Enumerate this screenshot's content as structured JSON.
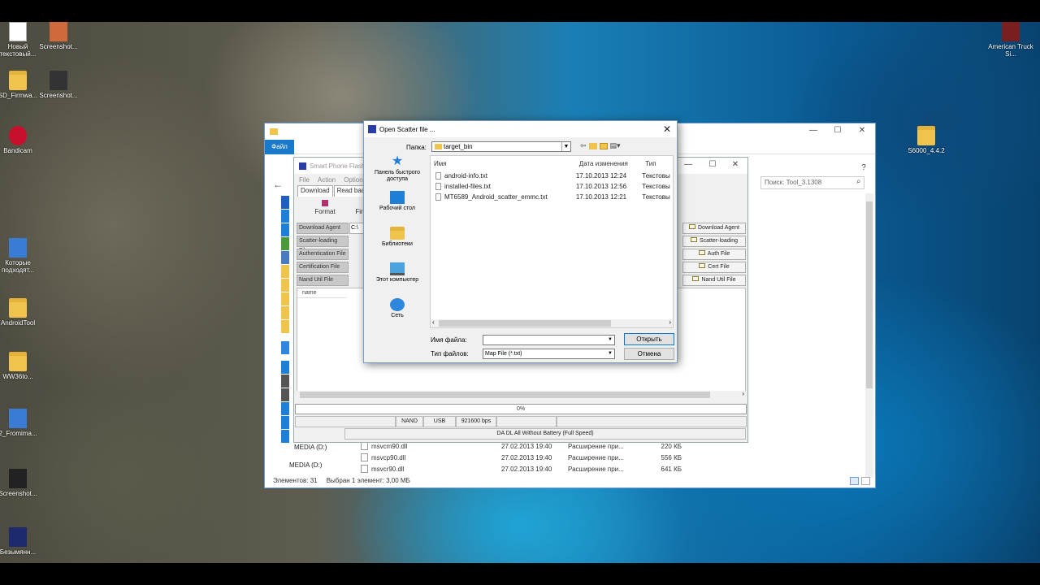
{
  "desktop": {
    "icons": [
      {
        "label": "Новый текстовый...",
        "kind": "file"
      },
      {
        "label": "Screenshot...",
        "kind": "file"
      },
      {
        "label": "SD_Firmwa...",
        "kind": "folder"
      },
      {
        "label": "Screenshot...",
        "kind": "file"
      },
      {
        "label": "Bandicam",
        "kind": "app"
      },
      {
        "label": "Которые подходят...",
        "kind": "app"
      },
      {
        "label": "AndroidTool",
        "kind": "folder"
      },
      {
        "label": "WW36to...",
        "kind": "folder"
      },
      {
        "label": "2_Fromima...",
        "kind": "app"
      },
      {
        "label": "Screenshot...",
        "kind": "file"
      },
      {
        "label": "Безымянн...",
        "kind": "app"
      },
      {
        "label": "American Truck Si...",
        "kind": "app"
      },
      {
        "label": "S6000_4.4.2",
        "kind": "folder"
      }
    ]
  },
  "explorer": {
    "file_tab": "Файл",
    "search_placeholder": "Поиск: Tool_3.1308",
    "rows": [
      {
        "name": "msvcm90.dll",
        "date": "27.02.2013 19:40",
        "type": "Расширение при...",
        "size": "220 КБ"
      },
      {
        "name": "msvcp90.dll",
        "date": "27.02.2013 19:40",
        "type": "Расширение при...",
        "size": "556 КБ"
      },
      {
        "name": "msvcr90.dll",
        "date": "27.02.2013 19:40",
        "type": "Расширение при...",
        "size": "641 КБ"
      }
    ],
    "drives": [
      "MEDIA (D:)",
      "MEDIA (D:)"
    ],
    "status_count": "Элементов: 31",
    "status_selected": "Выбран 1 элемент: 3,00 МБ"
  },
  "flashtool": {
    "title": "Smart Phone Flash",
    "menu": [
      "File",
      "Action",
      "Option"
    ],
    "tabs": [
      "Download",
      "Read back"
    ],
    "toolbar": [
      "Format",
      "Fir"
    ],
    "fields": [
      "Download Agent",
      "Scatter-loading File",
      "Authentication File",
      "Certification File",
      "Nand Util File"
    ],
    "buttons": [
      "Download Agent",
      "Scatter-loading",
      "Auth File",
      "Cert File",
      "Nand Util File"
    ],
    "path_prefix": "C:\\",
    "list_header": "name",
    "progress_percent": 0,
    "progress_text": "0%",
    "status": [
      "NAND",
      "USB",
      "921600 bps"
    ],
    "mode": "DA DL All Without Battery (Full Speed)"
  },
  "dialog": {
    "title": "Open Scatter file ...",
    "lookin_label": "Папка:",
    "lookin_value": "target_bin",
    "places": [
      "Панель быстрого доступа",
      "Рабочий стол",
      "Библиотеки",
      "Этот компьютер",
      "Сеть"
    ],
    "columns": [
      "Имя",
      "Дата изменения",
      "Тип"
    ],
    "files": [
      {
        "name": "android-info.txt",
        "date": "17.10.2013 12:24",
        "type": "Текстовы"
      },
      {
        "name": "installed-files.txt",
        "date": "17.10.2013 12:56",
        "type": "Текстовы"
      },
      {
        "name": "MT6589_Android_scatter_emmc.txt",
        "date": "17.10.2013 12:21",
        "type": "Текстовы"
      }
    ],
    "filename_label": "Имя файла:",
    "filename_value": "",
    "filetype_label": "Тип файлов:",
    "filetype_value": "Map File (*.txt)",
    "open_button": "Открыть",
    "cancel_button": "Отмена"
  }
}
